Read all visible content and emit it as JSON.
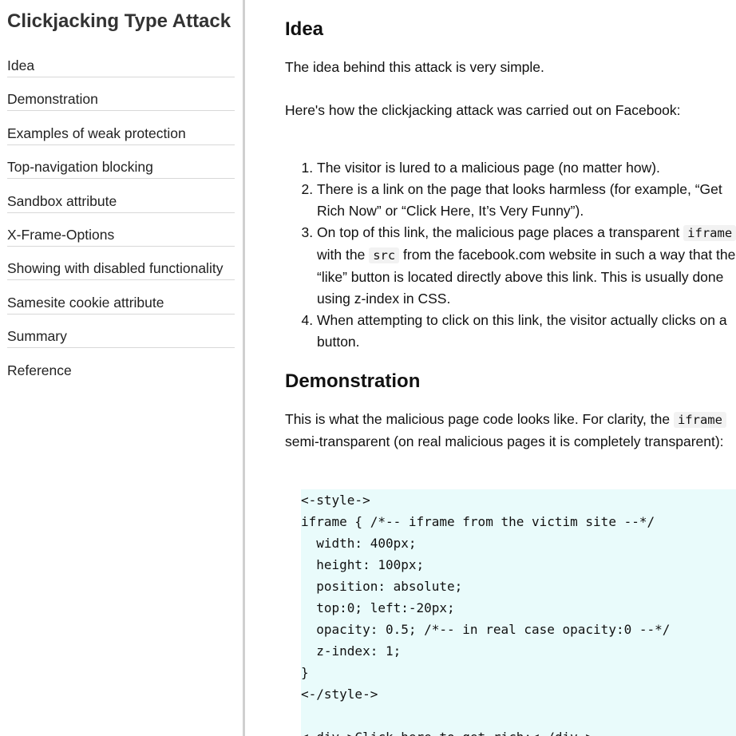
{
  "sidebar": {
    "title": "Clickjacking Type Attack",
    "items": [
      {
        "label": "Idea"
      },
      {
        "label": "Demonstration"
      },
      {
        "label": "Examples of weak protection"
      },
      {
        "label": "Top-navigation blocking"
      },
      {
        "label": "Sandbox attribute"
      },
      {
        "label": "X-Frame-Options"
      },
      {
        "label": "Showing with disabled functionality"
      },
      {
        "label": "Samesite cookie attribute"
      },
      {
        "label": "Summary"
      },
      {
        "label": "Reference"
      }
    ]
  },
  "idea": {
    "heading": "Idea",
    "p1": "The idea behind this attack is very simple.",
    "p2": "Here's how the clickjacking attack was carried out on Facebook:",
    "steps": {
      "s1": "The visitor is lured to a malicious page (no matter how).",
      "s2a": "There is a link on the page that looks harmless (for example, “Get",
      "s2b": "Rich Now” or “Click Here, It’s Very Funny”).",
      "s3a": "On top of this link, the malicious page places a transparent ",
      "s3_code1": "iframe",
      "s3b": "with the ",
      "s3_code2": "src",
      "s3c": " from the facebook.com website in such a way that the",
      "s3d": "“like” button is located directly above this link. This is usually done",
      "s3e": "using z-index in CSS.",
      "s4a": "When attempting to click on this link, the visitor actually clicks on a",
      "s4b": "button."
    }
  },
  "demo": {
    "heading": "Demonstration",
    "p1a": "This is what the malicious page code looks like. For clarity, the ",
    "p1_code": "iframe",
    "p1b": "semi-transparent (on real malicious pages it is completely transparent):",
    "code": "<-style->\niframe { /*-- iframe from the victim site --*/\n  width: 400px;\n  height: 100px;\n  position: absolute;\n  top:0; left:-20px;\n  opacity: 0.5; /*-- in real case opacity:0 --*/\n  z-index: 1;\n}\n<-/style->\n\n<-div->Click here to get rich:<-/div->"
  }
}
